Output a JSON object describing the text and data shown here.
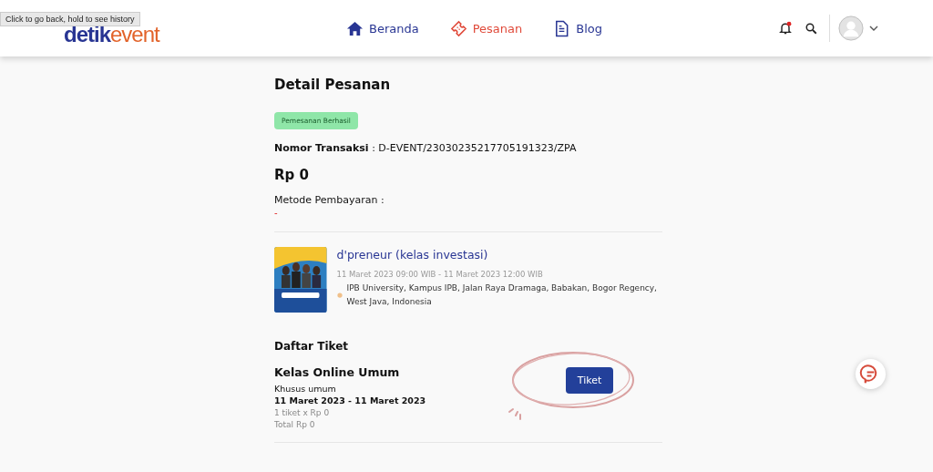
{
  "tooltip": "Click to go back, hold to see history",
  "logo": {
    "part_1": "detik",
    "part_2": "event"
  },
  "nav": [
    {
      "label": "Beranda",
      "kind": "home",
      "selected": false
    },
    {
      "label": "Pesanan",
      "kind": "ticket",
      "selected": true
    },
    {
      "label": "Blog",
      "kind": "document",
      "selected": false
    }
  ],
  "notifications": {
    "unread": true
  },
  "order": {
    "title": "Detail Pesanan",
    "status": "Pemesanan Berhasil",
    "transaction_label": "Nomor Transaksi",
    "transaction_value": ": D-EVENT/23030235217705191323/ZPA",
    "amount": "Rp 0",
    "payment_label": "Metode Pembayaran :",
    "payment_value": "-"
  },
  "event": {
    "name": "d'preneur (kelas investasi)",
    "datetime": "11 Maret 2023 09:00 WIB - 11 Maret 2023 12:00 WIB",
    "location": "IPB University, Kampus IPB, Jalan Raya Dramaga, Babakan, Bogor Regency, West Java, Indonesia"
  },
  "tickets": {
    "title": "Daftar Tiket",
    "items": [
      {
        "name": "Kelas Online Umum",
        "category": "Khusus umum",
        "dates": "11 Maret 2023 - 11 Maret 2023",
        "quantity": "1 tiket x Rp 0",
        "total": "Total Rp 0",
        "button": "Tiket"
      }
    ]
  }
}
